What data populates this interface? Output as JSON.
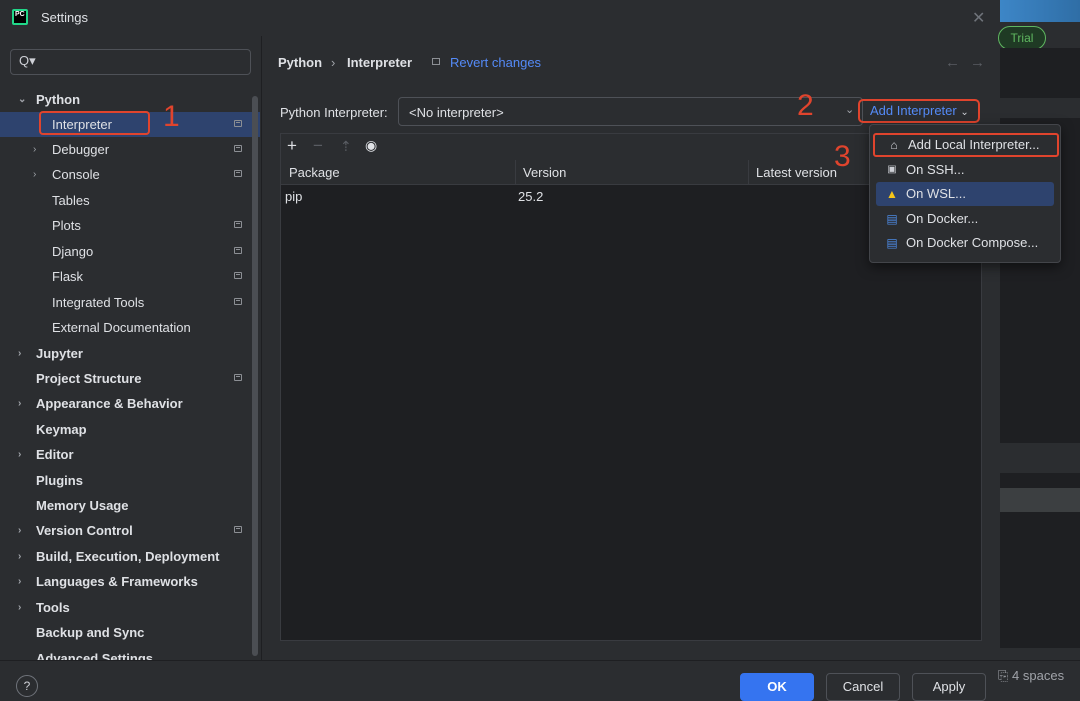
{
  "window": {
    "title": "Settings",
    "app_logo_text": "PC",
    "close_glyph": "✕"
  },
  "background": {
    "trial_badge": "Trial",
    "indent_indicator": "4 spaces"
  },
  "search": {
    "placeholder": ""
  },
  "sidebar": {
    "items": [
      {
        "label": "Python",
        "bold": true,
        "arrow": "expanded"
      },
      {
        "label": "Interpreter",
        "selected": true
      },
      {
        "label": "Debugger",
        "arrow": "collapsed"
      },
      {
        "label": "Console",
        "arrow": "collapsed"
      },
      {
        "label": "Tables"
      },
      {
        "label": "Plots"
      },
      {
        "label": "Django"
      },
      {
        "label": "Flask"
      },
      {
        "label": "Integrated Tools"
      },
      {
        "label": "External Documentation"
      },
      {
        "label": "Jupyter",
        "bold": true,
        "arrow": "collapsed"
      },
      {
        "label": "Project Structure",
        "bold": true
      },
      {
        "label": "Appearance & Behavior",
        "bold": true,
        "arrow": "collapsed"
      },
      {
        "label": "Keymap",
        "bold": true
      },
      {
        "label": "Editor",
        "bold": true,
        "arrow": "collapsed"
      },
      {
        "label": "Plugins",
        "bold": true
      },
      {
        "label": "Memory Usage",
        "bold": true
      },
      {
        "label": "Version Control",
        "bold": true,
        "arrow": "collapsed"
      },
      {
        "label": "Build, Execution, Deployment",
        "bold": true,
        "arrow": "collapsed"
      },
      {
        "label": "Languages & Frameworks",
        "bold": true,
        "arrow": "collapsed"
      },
      {
        "label": "Tools",
        "bold": true,
        "arrow": "collapsed"
      },
      {
        "label": "Backup and Sync",
        "bold": true
      },
      {
        "label": "Advanced Settings",
        "bold": true
      }
    ]
  },
  "breadcrumb": {
    "parent": "Python",
    "separator": "›",
    "current": "Interpreter",
    "revert": "Revert changes"
  },
  "interpreter": {
    "label": "Python Interpreter:",
    "value": "<No interpreter>",
    "add_button": "Add Interpreter"
  },
  "packages": {
    "columns": [
      "Package",
      "Version",
      "Latest version"
    ],
    "rows": [
      {
        "package": "pip",
        "version": "25.2",
        "latest": ""
      }
    ]
  },
  "add_menu": {
    "items": [
      {
        "label": "Add Local Interpreter...",
        "icon": "home-icon"
      },
      {
        "label": "On SSH...",
        "icon": "terminal-icon"
      },
      {
        "label": "On WSL...",
        "icon": "linux-icon"
      },
      {
        "label": "On Docker...",
        "icon": "docker-icon"
      },
      {
        "label": "On Docker Compose...",
        "icon": "docker-icon"
      }
    ]
  },
  "annotations": {
    "step1": "1",
    "step2": "2",
    "step3": "3"
  },
  "footer": {
    "help": "?",
    "ok": "OK",
    "cancel": "Cancel",
    "apply": "Apply"
  }
}
